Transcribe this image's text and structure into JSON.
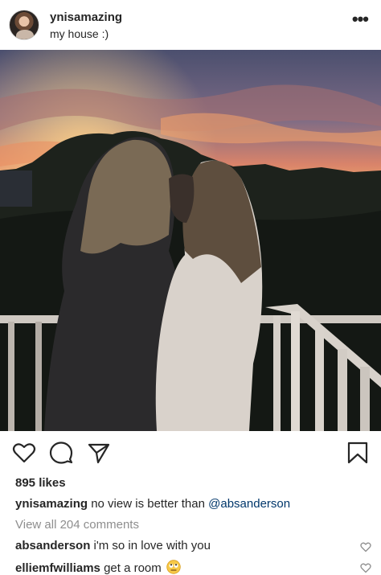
{
  "post": {
    "username": "ynisamazing",
    "location": "my house :)",
    "more_icon": "more-horizontal-icon"
  },
  "actions": {
    "like_icon": "heart-icon",
    "comment_icon": "comment-icon",
    "share_icon": "paper-plane-icon",
    "save_icon": "bookmark-icon"
  },
  "likes": "895 likes",
  "caption": {
    "username": "ynisamazing",
    "text": "no view is better than ",
    "mention": "@absanderson"
  },
  "view_all": "View all 204 comments",
  "comments": [
    {
      "username": "absanderson",
      "text": "i'm so in love with you",
      "like_icon": "heart-outline-icon"
    },
    {
      "username": "elliemfwilliams",
      "text": "get a room",
      "emoji": "eye-roll-emoji",
      "like_icon": "heart-outline-icon"
    }
  ]
}
